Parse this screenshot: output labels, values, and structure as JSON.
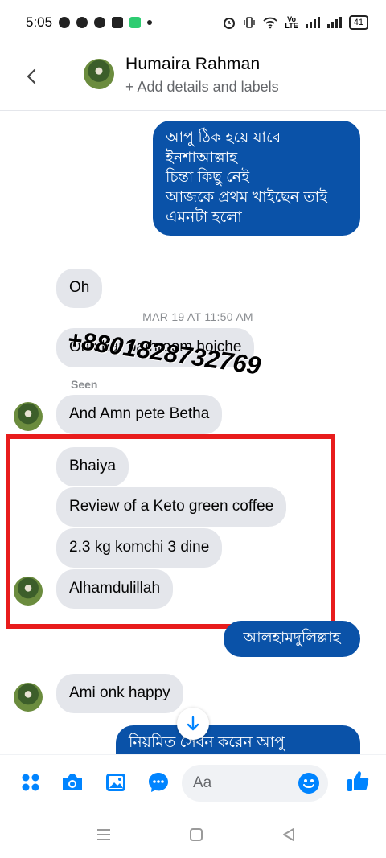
{
  "status_bar": {
    "time": "5:05",
    "volte_top": "Vo",
    "volte_bottom": "LTE",
    "battery": "41"
  },
  "header": {
    "name": "Humaira Rahman",
    "subtitle": "+ Add details and labels"
  },
  "messages": {
    "out_1_lines": [
      "আপু ঠিক হয়ে যাবে",
      "ইনশাআল্লাহ",
      "চিন্তা কিছু নেই",
      "আজকে প্রথম খাইছেন তাই",
      "এমনটা হলো"
    ],
    "in_oh": "Oh",
    "timestamp": "MAR 19 AT 11:50 AM",
    "in_bathroom": "Onk bar bathroom hoiche",
    "seen": "Seen",
    "in_pete": "And Amn pete Betha",
    "in_bhaiya": "Bhaiya",
    "in_review": "Review of a Keto green coffee",
    "in_komchi": "2.3 kg komchi 3 dine",
    "in_alhamdulillah": "Alhamdulillah",
    "out_alhamdulillah": "আলহামদুলিল্লাহ",
    "in_happy": "Ami onk happy",
    "out_last": "নিয়মিত সেবন করেন আপু"
  },
  "watermark": "+8801828732769",
  "composer": {
    "placeholder": "Aa"
  },
  "colors": {
    "accent": "#0a52a8",
    "messenger_blue": "#0084ff",
    "incoming_bubble": "#e4e6eb",
    "highlight_box": "#e81c1c"
  }
}
